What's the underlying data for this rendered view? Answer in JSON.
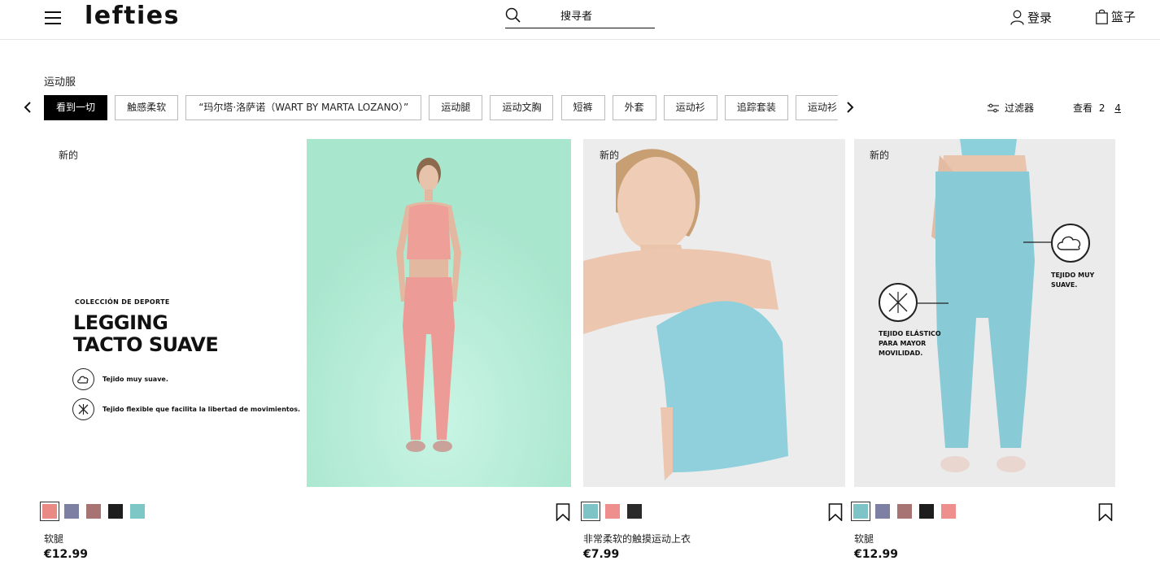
{
  "header": {
    "logo": "lefties",
    "search_placeholder": "搜寻者",
    "login_label": "登录",
    "cart_label": "篮子"
  },
  "category": {
    "title": "运动服",
    "chips": [
      "看到一切",
      "触感柔软",
      "“玛尔塔·洛萨诺（WART BY MARTA LOZANO）”",
      "运动腿",
      "运动文胸",
      "短裤",
      "外套",
      "运动衫",
      "追踪套装",
      "运动衫"
    ],
    "filter_label": "过滤器",
    "view_label": "查看",
    "view_options": [
      "2",
      "4"
    ]
  },
  "promo": {
    "new_label": "新的",
    "kicker": "COLECCIÓN DE DEPORTE",
    "title_line1": "LEGGING",
    "title_line2": "TACTO SUAVE",
    "feature1": "Tejido muy suave.",
    "feature2": "Tejido flexible que facilita la libertad de movimientos."
  },
  "products": [
    {
      "name": "软腿",
      "price": "€12.99",
      "new_label": "新的",
      "swatches": [
        "#e98a84",
        "#7d7fa3",
        "#a77473",
        "#1d1d1d",
        "#7ec7c7"
      ]
    },
    {
      "name": "非常柔软的触摸运动上衣",
      "price": "€7.99",
      "new_label": "新的",
      "swatches": [
        "#7ec3c6",
        "#ee8f8d",
        "#2a2a2a"
      ]
    },
    {
      "name": "软腿",
      "price": "€12.99",
      "new_label": "新的",
      "overlay1": "TEJIDO MUY SUAVE.",
      "overlay2_line1": "TEJIDO ELÁSTICO",
      "overlay2_line2": "PARA MAYOR",
      "overlay2_line3": "MOVILIDAD.",
      "swatches": [
        "#7ec3c6",
        "#7d7fa3",
        "#a77473",
        "#1d1d1d",
        "#ee8f8d"
      ]
    }
  ],
  "colors": {
    "accent": "#000000",
    "photo1_bg": "#b3ecd6",
    "photo2_bg": "#eceded",
    "photo3_bg": "#ececec"
  }
}
